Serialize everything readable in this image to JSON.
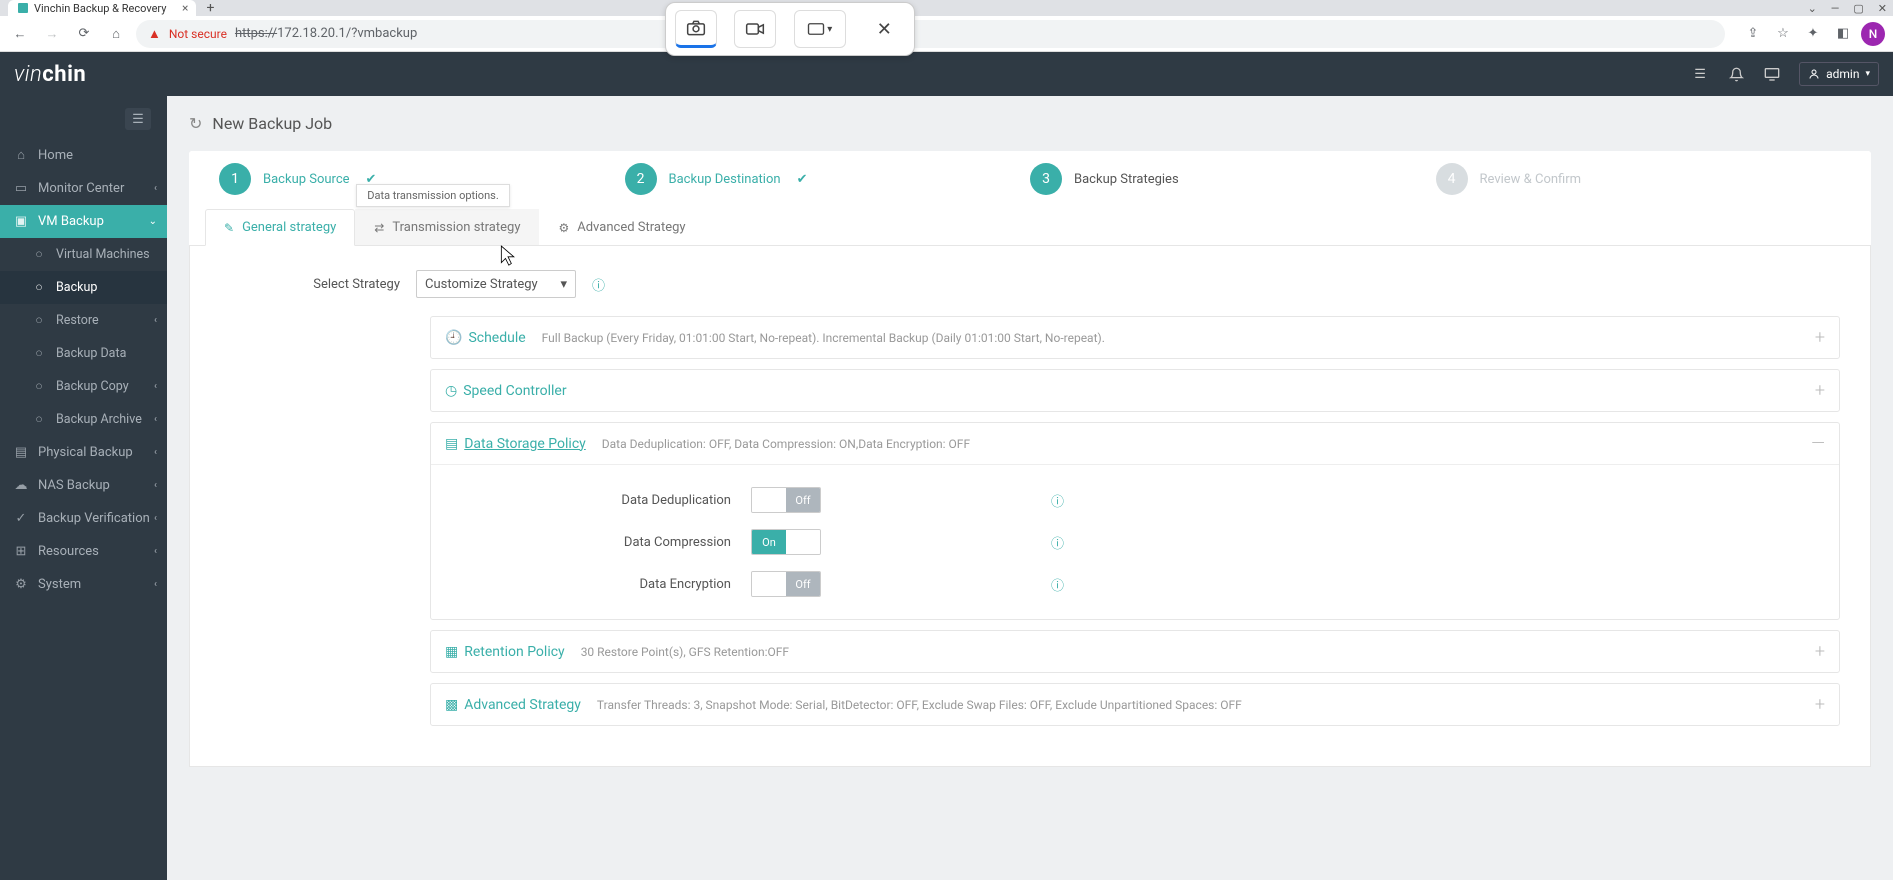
{
  "browser": {
    "tab_title": "Vinchin Backup & Recovery",
    "not_secure": "Not secure",
    "url_scheme": "https://",
    "url_host": "172.18.20.1",
    "url_path": "/?vmbackup",
    "avatar_letter": "N"
  },
  "header": {
    "user": "admin"
  },
  "sidebar": {
    "items": [
      {
        "label": "Home"
      },
      {
        "label": "Monitor Center"
      },
      {
        "label": "VM Backup"
      },
      {
        "label": "Virtual Machines"
      },
      {
        "label": "Backup"
      },
      {
        "label": "Restore"
      },
      {
        "label": "Backup Data"
      },
      {
        "label": "Backup Copy"
      },
      {
        "label": "Backup Archive"
      },
      {
        "label": "Physical Backup"
      },
      {
        "label": "NAS Backup"
      },
      {
        "label": "Backup Verification"
      },
      {
        "label": "Resources"
      },
      {
        "label": "System"
      }
    ]
  },
  "page": {
    "title": "New Backup Job"
  },
  "stepper": {
    "s1": {
      "num": "1",
      "label": "Backup Source"
    },
    "s2": {
      "num": "2",
      "label": "Backup Destination"
    },
    "s3": {
      "num": "3",
      "label": "Backup Strategies"
    },
    "s4": {
      "num": "4",
      "label": "Review & Confirm"
    }
  },
  "tabs": {
    "general": "General strategy",
    "transmission": "Transmission strategy",
    "advanced": "Advanced Strategy",
    "tooltip": "Data transmission options."
  },
  "form": {
    "select_label": "Select Strategy",
    "select_value": "Customize Strategy"
  },
  "panels": {
    "schedule": {
      "title": "Schedule",
      "sub": "Full Backup (Every Friday, 01:01:00 Start, No-repeat). Incremental Backup (Daily 01:01:00 Start, No-repeat)."
    },
    "speed": {
      "title": "Speed Controller"
    },
    "storage": {
      "title": "Data Storage Policy",
      "sub": "Data Deduplication: OFF, Data Compression: ON,Data Encryption: OFF",
      "dedup_label": "Data Deduplication",
      "comp_label": "Data Compression",
      "enc_label": "Data Encryption",
      "on": "On",
      "off": "Off"
    },
    "retention": {
      "title": "Retention Policy",
      "sub": "30 Restore Point(s), GFS Retention:OFF"
    },
    "adv": {
      "title": "Advanced Strategy",
      "sub": "Transfer Threads: 3, Snapshot Mode: Serial, BitDetector: OFF, Exclude Swap Files: OFF, Exclude Unpartitioned Spaces: OFF"
    }
  }
}
